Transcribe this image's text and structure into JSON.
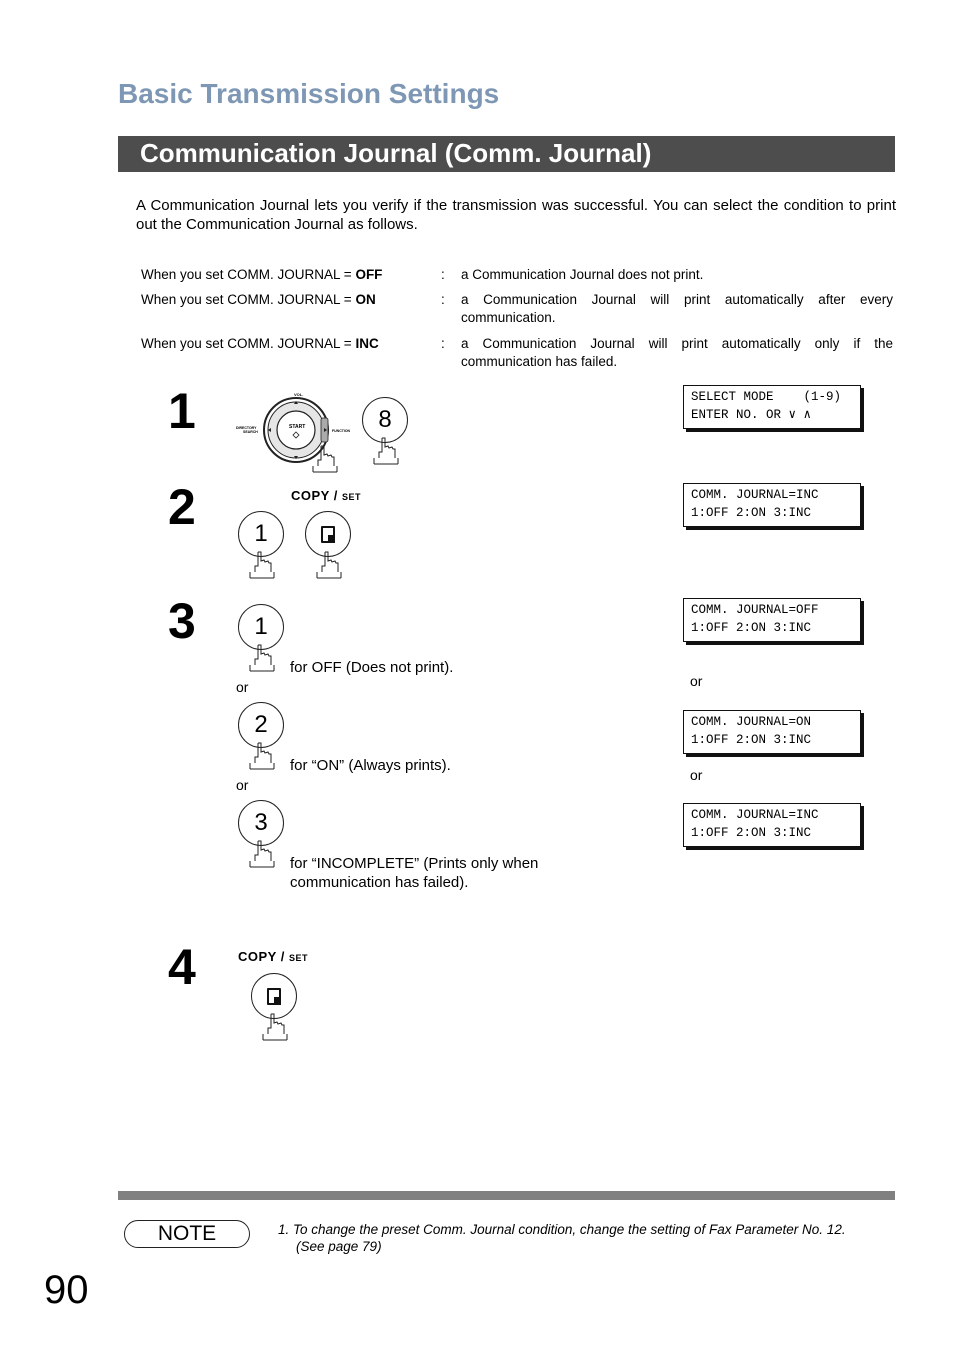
{
  "header": {
    "section_title": "Basic Transmission Settings",
    "page_title": "Communication Journal (Comm. Journal)"
  },
  "intro": "A Communication Journal lets you verify if the transmission was successful.  You can select the condition to print out the Communication Journal as follows.",
  "conditions": [
    {
      "label_prefix": "When you set COMM. JOURNAL = ",
      "value": "OFF",
      "colon": ":",
      "description": "a Communication Journal does not print."
    },
    {
      "label_prefix": "When you set COMM. JOURNAL = ",
      "value": "ON",
      "colon": ":",
      "description": "a Communication Journal will print automatically after every communication."
    },
    {
      "label_prefix": "When you set COMM. JOURNAL = ",
      "value": "INC",
      "colon": ":",
      "description": "a Communication Journal will print automatically only if the communication has failed."
    }
  ],
  "steps": {
    "step1": {
      "number": "1",
      "navpad": {
        "top_label": "VOL.",
        "left_label_1": "DIRECTORY",
        "left_label_2": "SEARCH",
        "right_label": "FUNCTION",
        "center_label": "START"
      },
      "key": "8",
      "lcd": {
        "line1": "SELECT MODE    (1-9)",
        "line2": "ENTER NO. OR ∨ ∧"
      }
    },
    "step2": {
      "number": "2",
      "copy_label": "COPY / ",
      "copy_label_small": "SET",
      "key": "1",
      "lcd": {
        "line1": "COMM. JOURNAL=INC",
        "line2": "1:OFF 2:ON 3:INC"
      }
    },
    "step3": {
      "number": "3",
      "options": [
        {
          "key": "1",
          "text": "for OFF (Does not print).",
          "lcd": {
            "line1": "COMM. JOURNAL=OFF",
            "line2": "1:OFF 2:ON 3:INC"
          }
        },
        {
          "key": "2",
          "text": "for “ON” (Always prints).",
          "lcd": {
            "line1": "COMM. JOURNAL=ON",
            "line2": "1:OFF 2:ON 3:INC"
          }
        },
        {
          "key": "3",
          "text_line1": "for “INCOMPLETE” (Prints only when",
          "text_line2": "communication has failed).",
          "lcd": {
            "line1": "COMM. JOURNAL=INC",
            "line2": "1:OFF 2:ON 3:INC"
          }
        }
      ],
      "or_label": "or"
    },
    "step4": {
      "number": "4",
      "copy_label": "COPY / ",
      "copy_label_small": "SET"
    }
  },
  "note": {
    "badge": "NOTE",
    "line1": "1.  To change the preset Comm. Journal condition, change the setting of Fax Parameter No. 12.",
    "line2": "(See page 79)"
  },
  "page_number": "90"
}
